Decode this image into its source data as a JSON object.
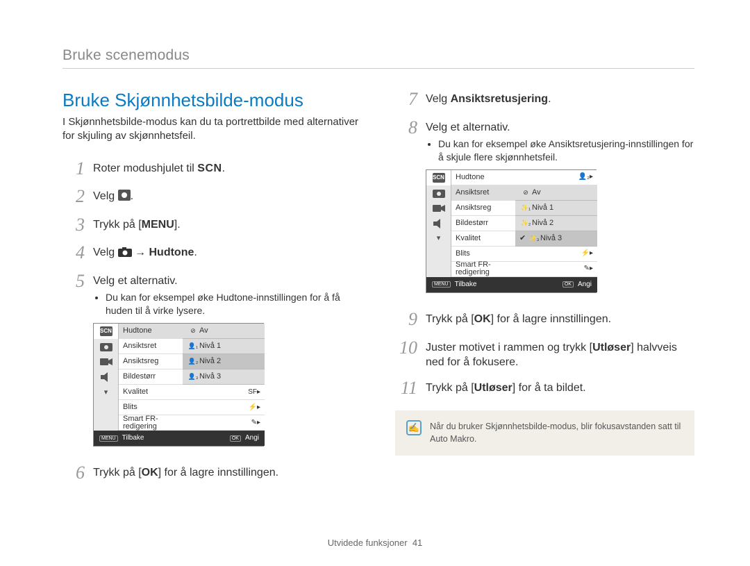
{
  "breadcrumb": "Bruke scenemodus",
  "section_title": "Bruke Skjønnhetsbilde-modus",
  "intro": "I Skjønnhetsbilde-modus kan du ta portrettbilde med alternativer for skjuling av skjønnhetsfeil.",
  "steps_left": [
    {
      "n": "1",
      "pre": "Roter modushjulet til ",
      "label": "SCN",
      "post": "."
    },
    {
      "n": "2",
      "text": "Velg ",
      "icon": true,
      "post": "."
    },
    {
      "n": "3",
      "pre": "Trykk på [",
      "bold": "MENU",
      "post": "]."
    },
    {
      "n": "4",
      "pre": "Velg ",
      "iconCam": true,
      "arrow": " → ",
      "bold": "Hudtone",
      "post": "."
    },
    {
      "n": "5",
      "text": "Velg et alternativ.",
      "sub": "Du kan for eksempel øke Hudtone-innstillingen for å få huden til å virke lysere."
    },
    {
      "n": "6",
      "pre": "Trykk på [",
      "ok": "OK",
      "post": "] for å lagre innstillingen."
    }
  ],
  "steps_right": [
    {
      "n": "7",
      "pre": "Velg ",
      "bold": "Ansiktsretusjering",
      "post": "."
    },
    {
      "n": "8",
      "text": "Velg et alternativ.",
      "sub": "Du kan for eksempel øke Ansiktsretusjering-innstillingen for å skjule flere skjønnhetsfeil."
    },
    {
      "n": "9",
      "pre": "Trykk på [",
      "ok": "OK",
      "post": "] for å lagre innstillingen."
    },
    {
      "n": "10",
      "pre": "Juster motivet i rammen og trykk [",
      "bold": "Utløser",
      "post": "] halvveis ned for å fokusere."
    },
    {
      "n": "11",
      "pre": "Trykk på [",
      "bold": "Utløser",
      "post": "] for å ta bildet."
    }
  ],
  "menu_left": {
    "rows": [
      "Hudtone",
      "Ansiktsret",
      "Ansiktsreg",
      "Bildestørr",
      "Kvalitet",
      "Blits",
      "Smart FR-redigering"
    ],
    "popup": [
      "Av",
      "Nivå 1",
      "Nivå 2",
      "Nivå 3"
    ],
    "popup_highlight_index": 2,
    "foot_left_icon": "MENU",
    "foot_left": "Tilbake",
    "foot_right_icon": "OK",
    "foot_right": "Angi"
  },
  "menu_right": {
    "rows": [
      "Hudtone",
      "Ansiktsret",
      "Ansiktsreg",
      "Bildestørr",
      "Kvalitet",
      "Blits",
      "Smart FR-redigering"
    ],
    "popup": [
      "Av",
      "Nivå 1",
      "Nivå 2",
      "Nivå 3"
    ],
    "popup_highlight_index": 3,
    "foot_left_icon": "MENU",
    "foot_left": "Tilbake",
    "foot_right_icon": "OK",
    "foot_right": "Angi"
  },
  "note": "Når du bruker Skjønnhetsbilde-modus, blir fokusavstanden satt til Auto Makro.",
  "footer_label": "Utvidede funksjoner",
  "footer_page": "41"
}
